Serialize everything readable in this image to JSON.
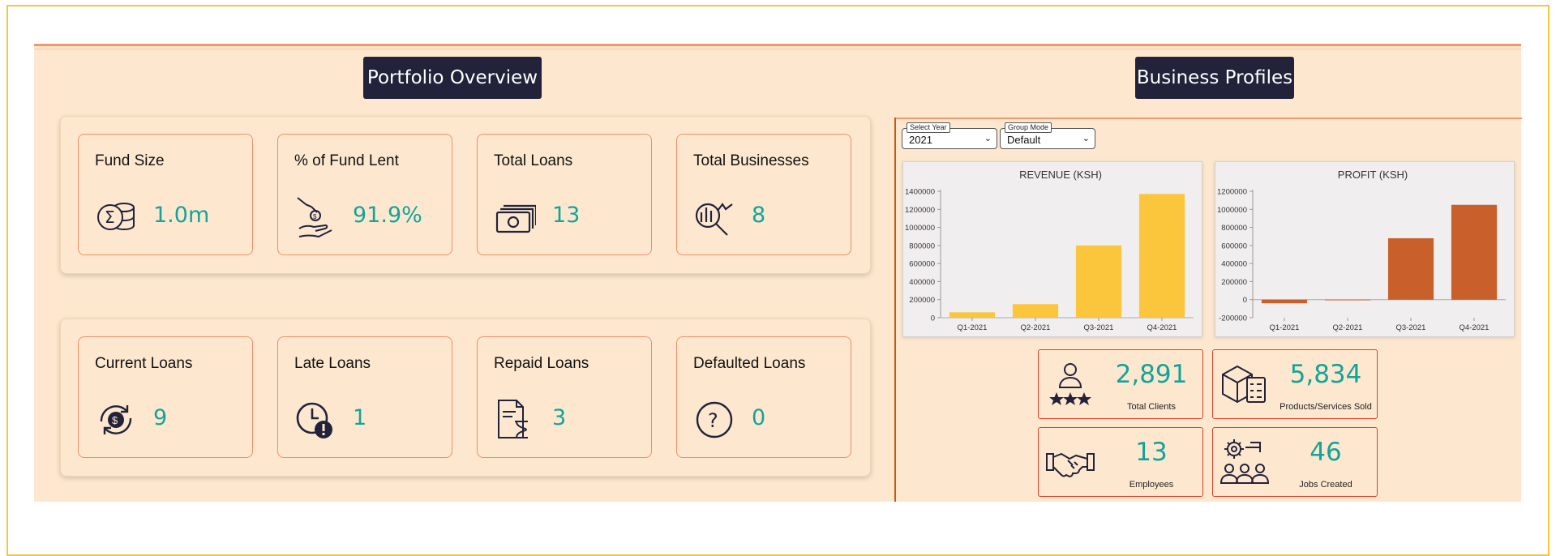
{
  "portfolio": {
    "title": "Portfolio Overview",
    "cards": [
      {
        "title": "Fund Size",
        "value": "1.0m",
        "icon": "fund-sum-icon"
      },
      {
        "title": "% of Fund Lent",
        "value": "91.9%",
        "icon": "hand-coin-icon"
      },
      {
        "title": "Total Loans",
        "value": "13",
        "icon": "cash-stack-icon"
      },
      {
        "title": "Total Businesses",
        "value": "8",
        "icon": "chart-search-icon"
      },
      {
        "title": "Current Loans",
        "value": "9",
        "icon": "refresh-coin-icon"
      },
      {
        "title": "Late Loans",
        "value": "1",
        "icon": "clock-alert-icon"
      },
      {
        "title": "Repaid Loans",
        "value": "3",
        "icon": "document-hourglass-icon"
      },
      {
        "title": "Defaulted Loans",
        "value": "0",
        "icon": "question-circle-icon"
      }
    ]
  },
  "business": {
    "title": "Business Profiles",
    "selects": {
      "year": {
        "legend": "Select Year",
        "value": "2021"
      },
      "group": {
        "legend": "Group Mode",
        "value": "Default"
      }
    },
    "stats": [
      {
        "value": "2,891",
        "label": "Total Clients",
        "icon": "clients-rating-icon"
      },
      {
        "value": "5,834",
        "label": "Products/Services Sold",
        "icon": "box-checklist-icon"
      },
      {
        "value": "13",
        "label": "Employees",
        "icon": "handshake-icon"
      },
      {
        "value": "46",
        "label": "Jobs Created",
        "icon": "gear-team-icon"
      }
    ]
  },
  "chart_data": [
    {
      "type": "bar",
      "title": "REVENUE (KSH)",
      "categories": [
        "Q1-2021",
        "Q2-2021",
        "Q3-2021",
        "Q4-2021"
      ],
      "values": [
        60000,
        150000,
        800000,
        1370000
      ],
      "ylim": [
        0,
        1400000
      ],
      "yticks": [
        0,
        200000,
        400000,
        600000,
        800000,
        1000000,
        1200000,
        1400000
      ],
      "color": "#fbc53c",
      "grid": false
    },
    {
      "type": "bar",
      "title": "PROFIT (KSH)",
      "categories": [
        "Q1-2021",
        "Q2-2021",
        "Q3-2021",
        "Q4-2021"
      ],
      "values": [
        -40000,
        0,
        680000,
        1050000
      ],
      "ylim": [
        -200000,
        1200000
      ],
      "yticks": [
        -200000,
        0,
        200000,
        400000,
        600000,
        800000,
        1000000,
        1200000
      ],
      "color": "#c9602b",
      "grid": false
    }
  ]
}
